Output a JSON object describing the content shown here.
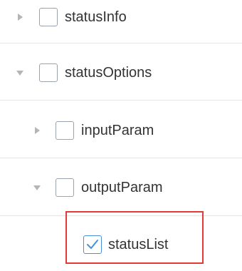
{
  "tree": {
    "nodes": [
      {
        "label": "statusInfo",
        "expanded": false,
        "checked": false,
        "caret_icon": "caret-right-icon"
      },
      {
        "label": "statusOptions",
        "expanded": true,
        "checked": false,
        "caret_icon": "caret-down-icon"
      },
      {
        "label": "inputParam",
        "expanded": false,
        "checked": false,
        "caret_icon": "caret-right-icon"
      },
      {
        "label": "outputParam",
        "expanded": true,
        "checked": false,
        "caret_icon": "caret-down-icon"
      },
      {
        "label": "statusList",
        "expanded": false,
        "checked": true,
        "caret_icon": ""
      }
    ]
  },
  "colors": {
    "highlight_border": "#e53935",
    "checkbox_check": "#4a90d9",
    "caret": "#a8a8a8",
    "divider": "#e6e6e6"
  }
}
